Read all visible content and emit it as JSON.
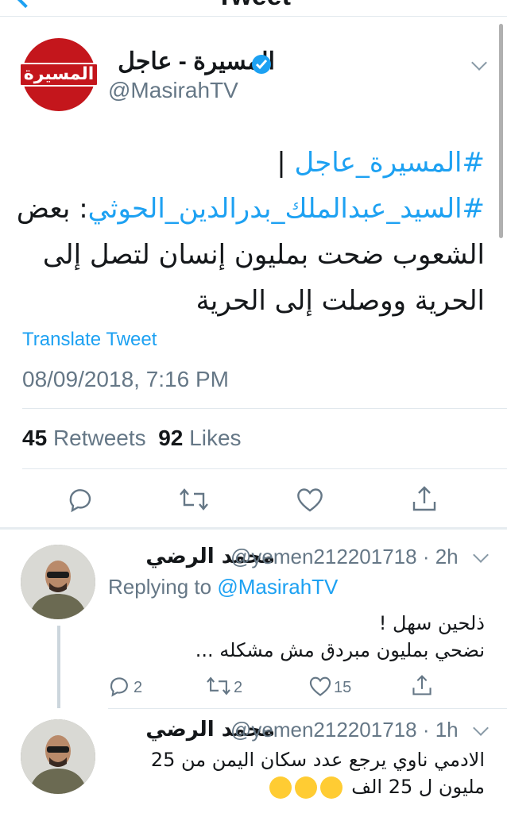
{
  "nav": {
    "title": "Tweet"
  },
  "main_tweet": {
    "display_name": "المسيرة - عاجل",
    "handle": "@MasirahTV",
    "avatar_text": "المسيرة",
    "lines": [
      {
        "hashtag": "#المسيرة_عاجل",
        "text": " |"
      },
      {
        "hashtag": "#السيد_عبدالملك_بدرالدين_الحوثي",
        "text": ": بعض"
      },
      {
        "hashtag": "",
        "text": "الشعوب ضحت بمليون إنسان لتصل إلى"
      },
      {
        "hashtag": "",
        "text": "الحرية ووصلت إلى الحرية"
      }
    ],
    "translate_label": "Translate Tweet",
    "timestamp": "08/09/2018, 7:16 PM",
    "retweets_count": "45",
    "retweets_label": "Retweets",
    "likes_count": "92",
    "likes_label": "Likes"
  },
  "replies": [
    {
      "display_name": "محمد الرضي",
      "handle": "@yemen212201718",
      "time": "· 2h",
      "replying_prefix": "Replying to ",
      "replying_handle": "@MasirahTV",
      "lines": [
        "ذلحين سهل !",
        "نضحي بمليون مبردق مش مشكله ..."
      ],
      "replies_count": "2",
      "retweets_count": "2",
      "likes_count": "15"
    },
    {
      "display_name": "محمد الرضي",
      "handle": "@yemen212201718",
      "time": "· 1h",
      "lines": [
        "الادمي ناوي يرجع عدد سكان اليمن من 25",
        "مليون ل 25 الف"
      ],
      "emoji": [
        "face-with-tears-of-joy-icon",
        "face-with-tears-of-joy-icon",
        "face-with-tears-of-joy-icon"
      ]
    }
  ],
  "colors": {
    "accent": "#1da1f2",
    "muted": "#657786",
    "brand_red": "#c4161c"
  }
}
